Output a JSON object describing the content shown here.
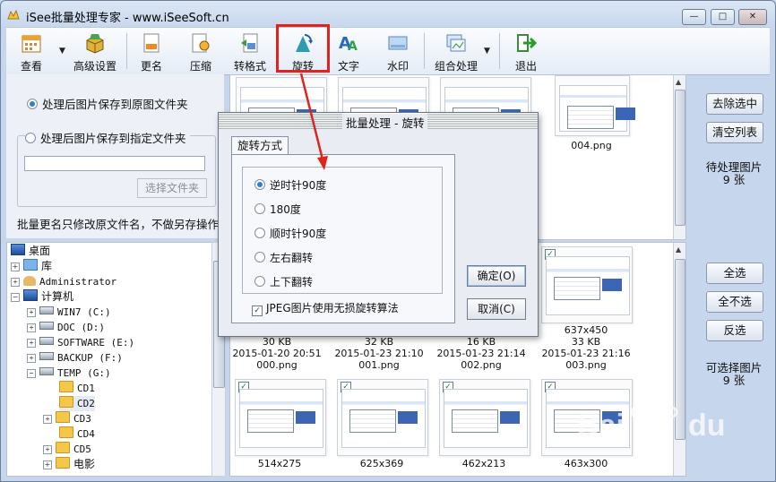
{
  "window": {
    "title": "iSee批量处理专家 - www.iSeeSoft.cn",
    "controls": {
      "minimize": "—",
      "maximize": "□",
      "close": "✕"
    }
  },
  "toolbar": {
    "items": [
      {
        "label": "查看",
        "icon": "calendar-view-icon"
      },
      {
        "label": "高级设置",
        "icon": "package-icon"
      },
      {
        "label": "更名",
        "icon": "rename-icon"
      },
      {
        "label": "压缩",
        "icon": "compress-icon"
      },
      {
        "label": "转格式",
        "icon": "convert-format-icon"
      },
      {
        "label": "旋转",
        "icon": "rotate-icon"
      },
      {
        "label": "文字",
        "icon": "text-icon"
      },
      {
        "label": "水印",
        "icon": "watermark-icon"
      },
      {
        "label": "组合处理",
        "icon": "combine-icon"
      },
      {
        "label": "退出",
        "icon": "exit-icon"
      }
    ],
    "dropdown_arrow": "▼"
  },
  "save_options": {
    "option_original": "处理后图片保存到原图文件夹",
    "option_specified": "处理后图片保存到指定文件夹",
    "folder_path": "",
    "choose_folder_button": "选择文件夹",
    "rename_note": "批量更名只修改原文件名，不做另存操作",
    "selected": "original"
  },
  "tree": {
    "items": [
      {
        "label": "桌面",
        "icon": "desktop-icon",
        "expander": ""
      },
      {
        "label": "库",
        "icon": "library-icon",
        "expander": "+"
      },
      {
        "label": "Administrator",
        "icon": "user-folder-icon",
        "expander": "+"
      },
      {
        "label": "计算机",
        "icon": "computer-icon",
        "expander": "−"
      },
      {
        "label": "WIN7 (C:)",
        "icon": "drive-icon",
        "expander": "+"
      },
      {
        "label": "DOC (D:)",
        "icon": "drive-icon",
        "expander": "+"
      },
      {
        "label": "SOFTWARE (E:)",
        "icon": "drive-icon",
        "expander": "+"
      },
      {
        "label": "BACKUP (F:)",
        "icon": "drive-icon",
        "expander": "+"
      },
      {
        "label": "TEMP (G:)",
        "icon": "drive-icon",
        "expander": "−"
      },
      {
        "label": "CD1",
        "icon": "folder-icon",
        "expander": ""
      },
      {
        "label": "CD2",
        "icon": "folder-icon",
        "expander": ""
      },
      {
        "label": "CD3",
        "icon": "folder-icon",
        "expander": "+"
      },
      {
        "label": "CD4",
        "icon": "folder-icon",
        "expander": ""
      },
      {
        "label": "CD5",
        "icon": "folder-icon",
        "expander": "+"
      },
      {
        "label": "电影",
        "icon": "folder-icon",
        "expander": "+"
      }
    ]
  },
  "pending": {
    "visible_filename": "004.png",
    "buttons": {
      "remove_selected": "去除选中",
      "clear_list": "清空列表"
    },
    "label": "待处理图片",
    "count": "9 张"
  },
  "available": {
    "cards_row1": [
      {
        "dims": "",
        "size": "30 KB",
        "date": "2015-01-20 20:51",
        "name": "000.png",
        "checked": false
      },
      {
        "dims": "",
        "size": "32 KB",
        "date": "2015-01-23 21:10",
        "name": "001.png",
        "checked": false
      },
      {
        "dims": "",
        "size": "16 KB",
        "date": "2015-01-23 21:14",
        "name": "002.png",
        "checked": false
      },
      {
        "dims": "637x450",
        "size": "33 KB",
        "date": "2015-01-23 21:16",
        "name": "003.png",
        "checked": true
      }
    ],
    "cards_row2": [
      {
        "dims": "514x275",
        "checked": true
      },
      {
        "dims": "625x369",
        "checked": true
      },
      {
        "dims": "462x213",
        "checked": true
      },
      {
        "dims": "463x300",
        "checked": true
      }
    ],
    "buttons": {
      "select_all": "全选",
      "select_none": "全不选",
      "invert": "反选"
    },
    "label": "可选择图片",
    "count": "9 张"
  },
  "dialog": {
    "title": "批量处理 - 旋转",
    "tab": "旋转方式",
    "options": [
      "逆时针90度",
      "180度",
      "顺时针90度",
      "左右翻转",
      "上下翻转"
    ],
    "selected_index": 0,
    "jpeg_lossless": "JPEG图片使用无损旋转算法",
    "jpeg_checked": true,
    "ok": "确定(O)",
    "cancel": "取消(C)"
  },
  "colors": {
    "highlight": "#e0231b",
    "accent": "#2f7fd0"
  }
}
